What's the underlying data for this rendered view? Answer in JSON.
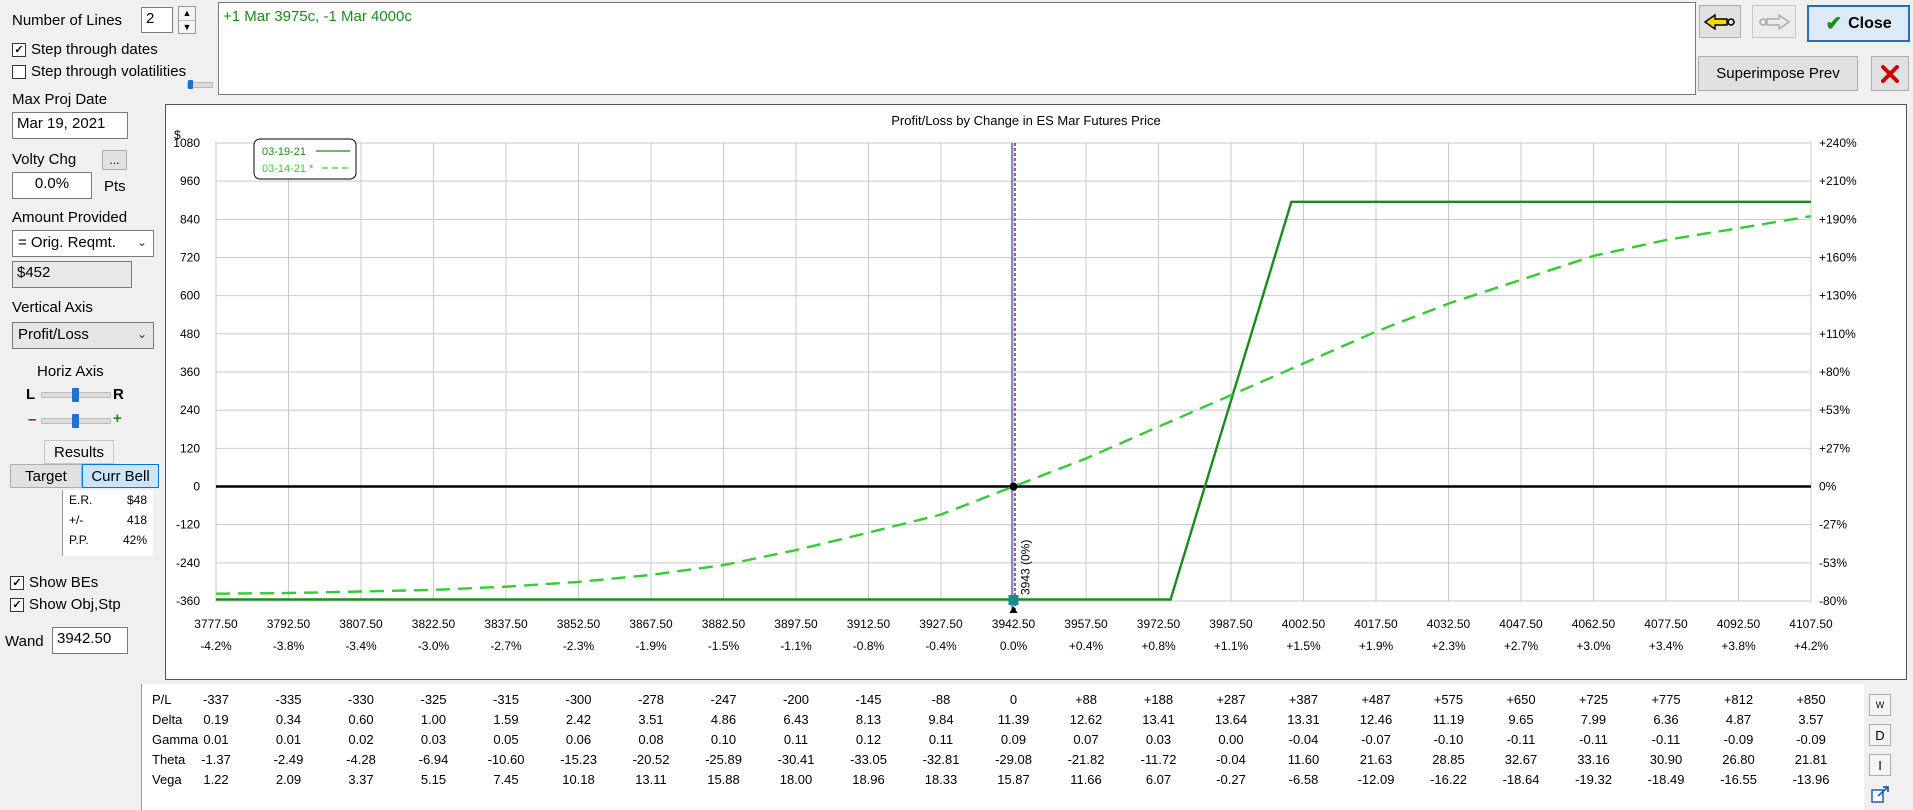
{
  "left_panel": {
    "number_of_lines_label": "Number of Lines",
    "number_of_lines_value": "2",
    "step_dates_label": "Step through dates",
    "step_dates_checked": true,
    "step_vol_label": "Step through volatilities",
    "step_vol_checked": false,
    "max_proj_date_label": "Max Proj Date",
    "max_proj_date_value": "Mar 19, 2021",
    "volty_chg_label": "Volty Chg",
    "volty_more_label": "...",
    "volty_chg_value": "0.0%",
    "volty_unit": "Pts",
    "amount_provided_label": "Amount Provided",
    "amount_provided_value": "= Orig. Reqmt.",
    "amount_value": "$452",
    "vertical_axis_label": "Vertical Axis",
    "vertical_axis_value": "Profit/Loss",
    "horiz_axis_label": "Horiz Axis",
    "horiz_left": "L",
    "horiz_right": "R",
    "zoom_minus": "–",
    "zoom_plus": "+",
    "results_label": "Results",
    "target_button": "Target",
    "curr_bell_button": "Curr Bell",
    "results": [
      {
        "k": "E.R.",
        "v": "$48"
      },
      {
        "k": "+/-",
        "v": "418"
      },
      {
        "k": "P.P.",
        "v": "42%"
      }
    ],
    "show_bes_label": "Show BEs",
    "show_bes_checked": true,
    "show_obj_label": "Show Obj,Stp",
    "show_obj_checked": true,
    "wand_label": "Wand",
    "wand_value": "3942.50"
  },
  "strategy_text": "+1 Mar 3975c, -1 Mar 4000c",
  "toolbar": {
    "back_icon": "left-arrow-icon",
    "forward_icon": "right-arrow-icon",
    "close_label": "Close",
    "superimpose_label": "Superimpose Prev",
    "delete_icon": "red-x-icon"
  },
  "colors": {
    "line_expiry": "#1a8c1a",
    "line_current": "#33cc33",
    "wand_line": "#9a2a8a",
    "zero_line": "#000000"
  },
  "chart_data": {
    "type": "line",
    "title": "Profit/Loss by Change in ES Mar Futures Price",
    "ylabel": "$",
    "ylim": [
      -360,
      1080
    ],
    "yticks": [
      "1080",
      "960",
      "840",
      "720",
      "600",
      "480",
      "360",
      "240",
      "120",
      "0",
      "-120",
      "-240",
      "-360"
    ],
    "y2ticks": [
      "+240%",
      "+210%",
      "+190%",
      "+160%",
      "+130%",
      "+110%",
      "+80%",
      "+53%",
      "+27%",
      "0%",
      "-27%",
      "-53%",
      "-80%"
    ],
    "xlim": [
      3777.5,
      4107.5
    ],
    "xticks": [
      "3777.50",
      "3792.50",
      "3807.50",
      "3822.50",
      "3837.50",
      "3852.50",
      "3867.50",
      "3882.50",
      "3897.50",
      "3912.50",
      "3927.50",
      "3942.50",
      "3957.50",
      "3972.50",
      "3987.50",
      "4002.50",
      "4017.50",
      "4032.50",
      "4047.50",
      "4062.50",
      "4077.50",
      "4092.50",
      "4107.50"
    ],
    "xticks_pct": [
      "-4.2%",
      "-3.8%",
      "-3.4%",
      "-3.0%",
      "-2.7%",
      "-2.3%",
      "-1.9%",
      "-1.5%",
      "-1.1%",
      "-0.8%",
      "-0.4%",
      "0.0%",
      "+0.4%",
      "+0.8%",
      "+1.1%",
      "+1.5%",
      "+1.9%",
      "+2.3%",
      "+2.7%",
      "+3.0%",
      "+3.4%",
      "+3.8%",
      "+4.2%"
    ],
    "grid": true,
    "legend": "top-left",
    "wand_x": 3942.5,
    "wand_label": "3943 (0%)",
    "series": [
      {
        "name": "03-19-21",
        "style": "solid",
        "x": [
          3777.5,
          3975,
          4000,
          4107.5
        ],
        "y": [
          -355,
          -355,
          895,
          895
        ]
      },
      {
        "name": "03-14-21 *",
        "style": "dashed",
        "x": [
          3777.5,
          3792.5,
          3807.5,
          3822.5,
          3837.5,
          3852.5,
          3867.5,
          3882.5,
          3897.5,
          3912.5,
          3927.5,
          3942.5,
          3957.5,
          3972.5,
          3987.5,
          4002.5,
          4017.5,
          4032.5,
          4047.5,
          4062.5,
          4077.5,
          4092.5,
          4107.5
        ],
        "y": [
          -337,
          -335,
          -330,
          -325,
          -315,
          -300,
          -278,
          -247,
          -200,
          -145,
          -88,
          0,
          88,
          188,
          287,
          387,
          487,
          575,
          650,
          725,
          775,
          812,
          850
        ]
      }
    ]
  },
  "greeks_table": {
    "rows": [
      {
        "name": "P/L",
        "values": [
          "-337",
          "-335",
          "-330",
          "-325",
          "-315",
          "-300",
          "-278",
          "-247",
          "-200",
          "-145",
          "-88",
          "0",
          "+88",
          "+188",
          "+287",
          "+387",
          "+487",
          "+575",
          "+650",
          "+725",
          "+775",
          "+812",
          "+850"
        ]
      },
      {
        "name": "Delta",
        "values": [
          "0.19",
          "0.34",
          "0.60",
          "1.00",
          "1.59",
          "2.42",
          "3.51",
          "4.86",
          "6.43",
          "8.13",
          "9.84",
          "11.39",
          "12.62",
          "13.41",
          "13.64",
          "13.31",
          "12.46",
          "11.19",
          "9.65",
          "7.99",
          "6.36",
          "4.87",
          "3.57"
        ]
      },
      {
        "name": "Gamma",
        "values": [
          "0.01",
          "0.01",
          "0.02",
          "0.03",
          "0.05",
          "0.06",
          "0.08",
          "0.10",
          "0.11",
          "0.12",
          "0.11",
          "0.09",
          "0.07",
          "0.03",
          "0.00",
          "-0.04",
          "-0.07",
          "-0.10",
          "-0.11",
          "-0.11",
          "-0.11",
          "-0.09",
          "-0.09"
        ]
      },
      {
        "name": "Theta",
        "values": [
          "-1.37",
          "-2.49",
          "-4.28",
          "-6.94",
          "-10.60",
          "-15.23",
          "-20.52",
          "-25.89",
          "-30.41",
          "-33.05",
          "-32.81",
          "-29.08",
          "-21.82",
          "-11.72",
          "-0.04",
          "11.60",
          "21.63",
          "28.85",
          "32.67",
          "33.16",
          "30.90",
          "26.80",
          "21.81"
        ]
      },
      {
        "name": "Vega",
        "values": [
          "1.22",
          "2.09",
          "3.37",
          "5.15",
          "7.45",
          "10.18",
          "13.11",
          "15.88",
          "18.00",
          "18.96",
          "18.33",
          "15.87",
          "11.66",
          "6.07",
          "-0.27",
          "-6.58",
          "-12.09",
          "-16.22",
          "-18.64",
          "-19.32",
          "-18.49",
          "-16.55",
          "-13.96"
        ]
      }
    ],
    "side_buttons": [
      "W",
      "D",
      "I"
    ]
  }
}
